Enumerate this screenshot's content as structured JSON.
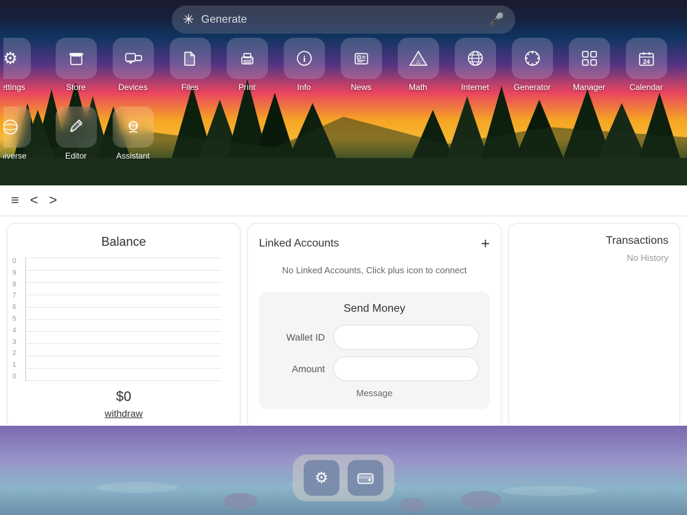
{
  "search": {
    "placeholder": "Generate"
  },
  "apps_row1": [
    {
      "id": "settings",
      "label": "Settings",
      "icon": "⚙",
      "partial": true
    },
    {
      "id": "store",
      "label": "Store",
      "icon": "🏪"
    },
    {
      "id": "devices",
      "label": "Devices",
      "icon": "🖥"
    },
    {
      "id": "files",
      "label": "Files",
      "icon": "📁"
    },
    {
      "id": "print",
      "label": "Print",
      "icon": "🖨"
    },
    {
      "id": "info",
      "label": "Info",
      "icon": "ℹ"
    },
    {
      "id": "news",
      "label": "News",
      "icon": "📰"
    },
    {
      "id": "math",
      "label": "Math",
      "icon": "🔷"
    },
    {
      "id": "internet",
      "label": "Internet",
      "icon": "🌐"
    },
    {
      "id": "generator",
      "label": "Generator",
      "icon": "✳"
    },
    {
      "id": "manager",
      "label": "Manager",
      "icon": "🔲"
    },
    {
      "id": "calendar",
      "label": "Calendar",
      "icon": "📅"
    }
  ],
  "apps_row2": [
    {
      "id": "universe",
      "label": "Universe",
      "icon": "🌍",
      "partial": true
    },
    {
      "id": "editor",
      "label": "Editor",
      "icon": "✏"
    },
    {
      "id": "assistant",
      "label": "Assistant",
      "icon": "🤖"
    }
  ],
  "nav": {
    "menu_icon": "≡",
    "back_icon": "<",
    "forward_icon": ">"
  },
  "balance_card": {
    "title": "Balance",
    "amount": "$0",
    "withdraw_label": "withdraw",
    "y_labels": [
      "0",
      "1",
      "2",
      "3",
      "4",
      "5",
      "6",
      "7",
      "8",
      "9",
      "0"
    ]
  },
  "linked_accounts": {
    "title": "Linked Accounts",
    "plus_label": "+",
    "no_accounts_msg": "No Linked Accounts, Click plus icon to connect"
  },
  "send_money": {
    "title": "Send Money",
    "wallet_id_label": "Wallet ID",
    "amount_label": "Amount",
    "message_label": "Message"
  },
  "transactions": {
    "title": "Transactions",
    "no_history": "No History"
  },
  "dock": [
    {
      "id": "settings-dock",
      "icon": "⚙"
    },
    {
      "id": "wallet-dock",
      "icon": "👛"
    }
  ]
}
